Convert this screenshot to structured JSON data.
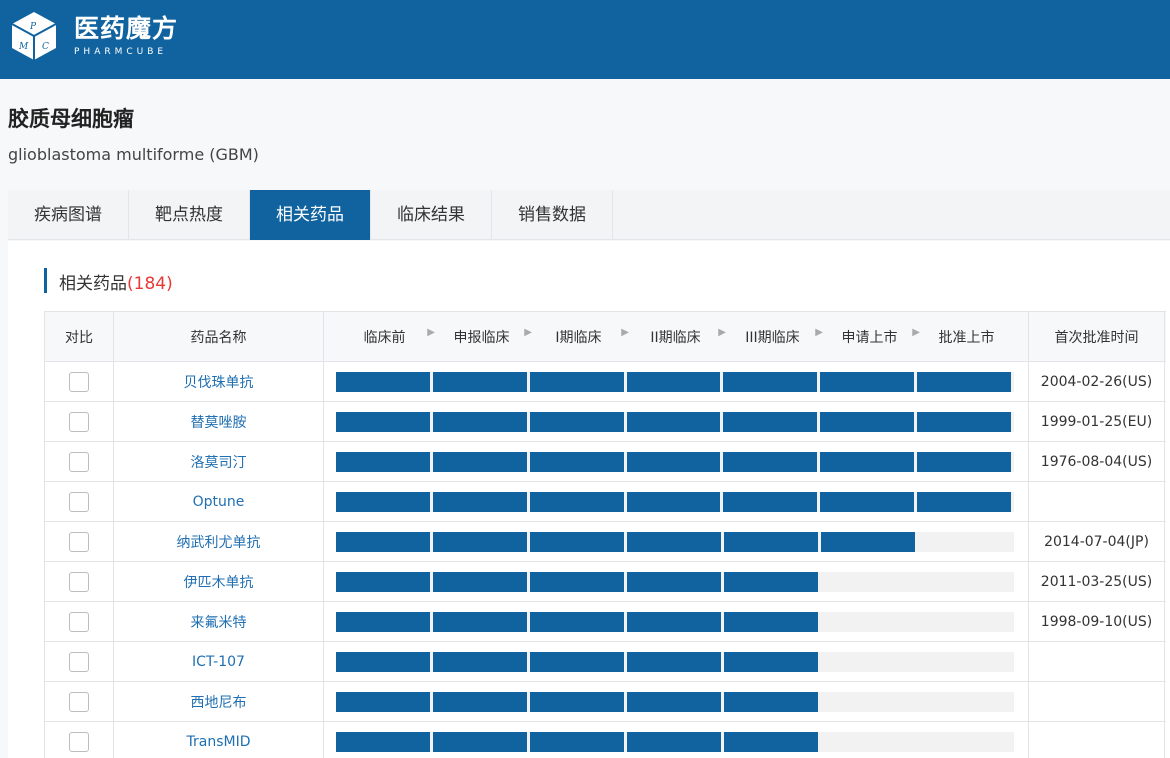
{
  "brand": {
    "name_cn": "医药魔方",
    "name_en": "PHARMCUBE",
    "logo_letters": [
      "P",
      "M",
      "C"
    ]
  },
  "disease": {
    "title": "胶质母细胞瘤",
    "subtitle": "glioblastoma multiforme (GBM)"
  },
  "tabs": [
    {
      "label": "疾病图谱",
      "active": false
    },
    {
      "label": "靶点热度",
      "active": false
    },
    {
      "label": "相关药品",
      "active": true
    },
    {
      "label": "临床结果",
      "active": false
    },
    {
      "label": "销售数据",
      "active": false
    }
  ],
  "section": {
    "title": "相关药品",
    "count": "(184)"
  },
  "table": {
    "headers": {
      "compare": "对比",
      "name": "药品名称",
      "first_approval": "首次批准时间"
    },
    "stages": [
      "临床前",
      "申报临床",
      "I期临床",
      "II期临床",
      "III期临床",
      "申请上市",
      "批准上市"
    ],
    "rows": [
      {
        "name": "贝伐珠单抗",
        "stages_completed": 7,
        "date": "2004-02-26(US)"
      },
      {
        "name": "替莫唑胺",
        "stages_completed": 7,
        "date": "1999-01-25(EU)"
      },
      {
        "name": "洛莫司汀",
        "stages_completed": 7,
        "date": "1976-08-04(US)"
      },
      {
        "name": "Optune",
        "stages_completed": 7,
        "date": ""
      },
      {
        "name": "纳武利尤单抗",
        "stages_completed": 6,
        "date": "2014-07-04(JP)"
      },
      {
        "name": "伊匹木单抗",
        "stages_completed": 5,
        "date": "2011-03-25(US)"
      },
      {
        "name": "来氟米特",
        "stages_completed": 5,
        "date": "1998-09-10(US)"
      },
      {
        "name": "ICT-107",
        "stages_completed": 5,
        "date": ""
      },
      {
        "name": "西地尼布",
        "stages_completed": 5,
        "date": ""
      },
      {
        "name": "TransMID",
        "stages_completed": 5,
        "date": ""
      }
    ]
  },
  "colors": {
    "primary": "#11639f",
    "link": "#1f6fb2",
    "count": "#e53935"
  }
}
